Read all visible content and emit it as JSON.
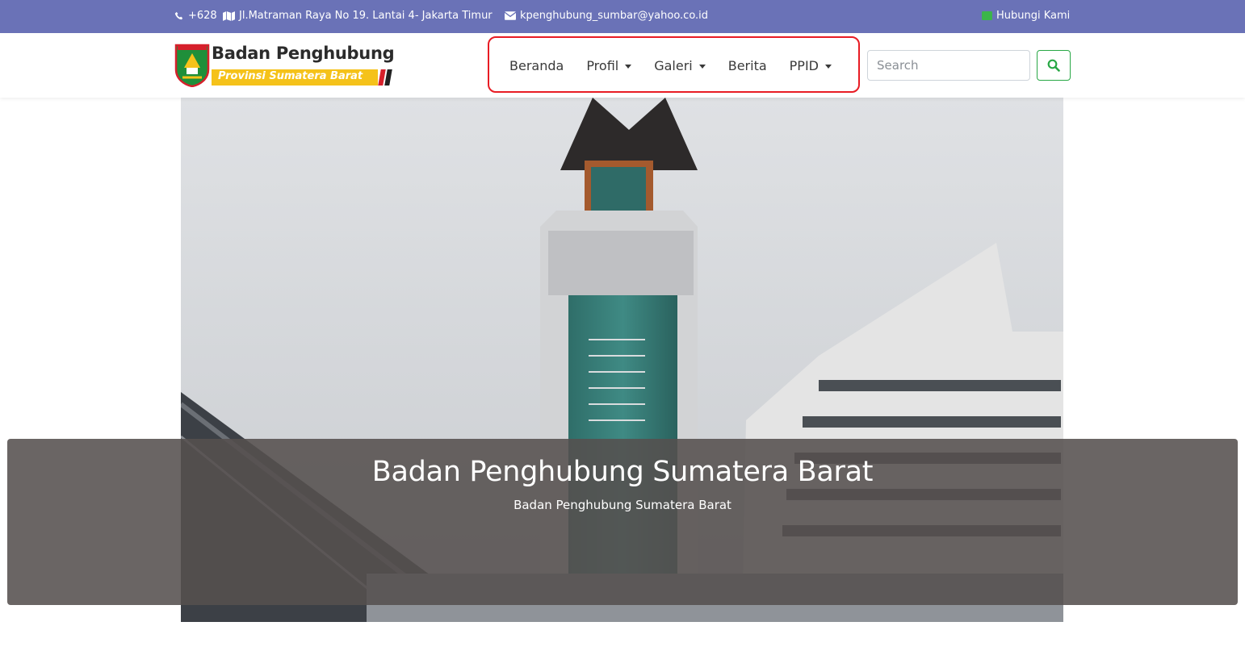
{
  "topbar": {
    "phone": "+628",
    "address": "Jl.Matraman Raya No 19. Lantai 4- Jakarta Timur",
    "email": "kpenghubung_sumbar@yahoo.co.id",
    "contact": "Hubungi Kami",
    "background": "#6a72b7"
  },
  "brand": {
    "title": "Badan Penghubung",
    "subtitle": "Provinsi Sumatera Barat",
    "accent_yellow": "#f5c21a",
    "accent_red": "#d6202b"
  },
  "nav": {
    "items": [
      {
        "label": "Beranda",
        "dropdown": false
      },
      {
        "label": "Profil",
        "dropdown": true
      },
      {
        "label": "Galeri",
        "dropdown": true
      },
      {
        "label": "Berita",
        "dropdown": false
      },
      {
        "label": "PPID",
        "dropdown": true
      }
    ],
    "highlight_color": "#e81c24"
  },
  "search": {
    "placeholder": "Search",
    "value": "",
    "button_icon": "search-icon",
    "button_color": "#28a745"
  },
  "hero": {
    "image": "tower-building-photo",
    "caption_title": "Badan Penghubung Sumatera Barat",
    "caption_subtitle": "Badan Penghubung Sumatera Barat"
  }
}
